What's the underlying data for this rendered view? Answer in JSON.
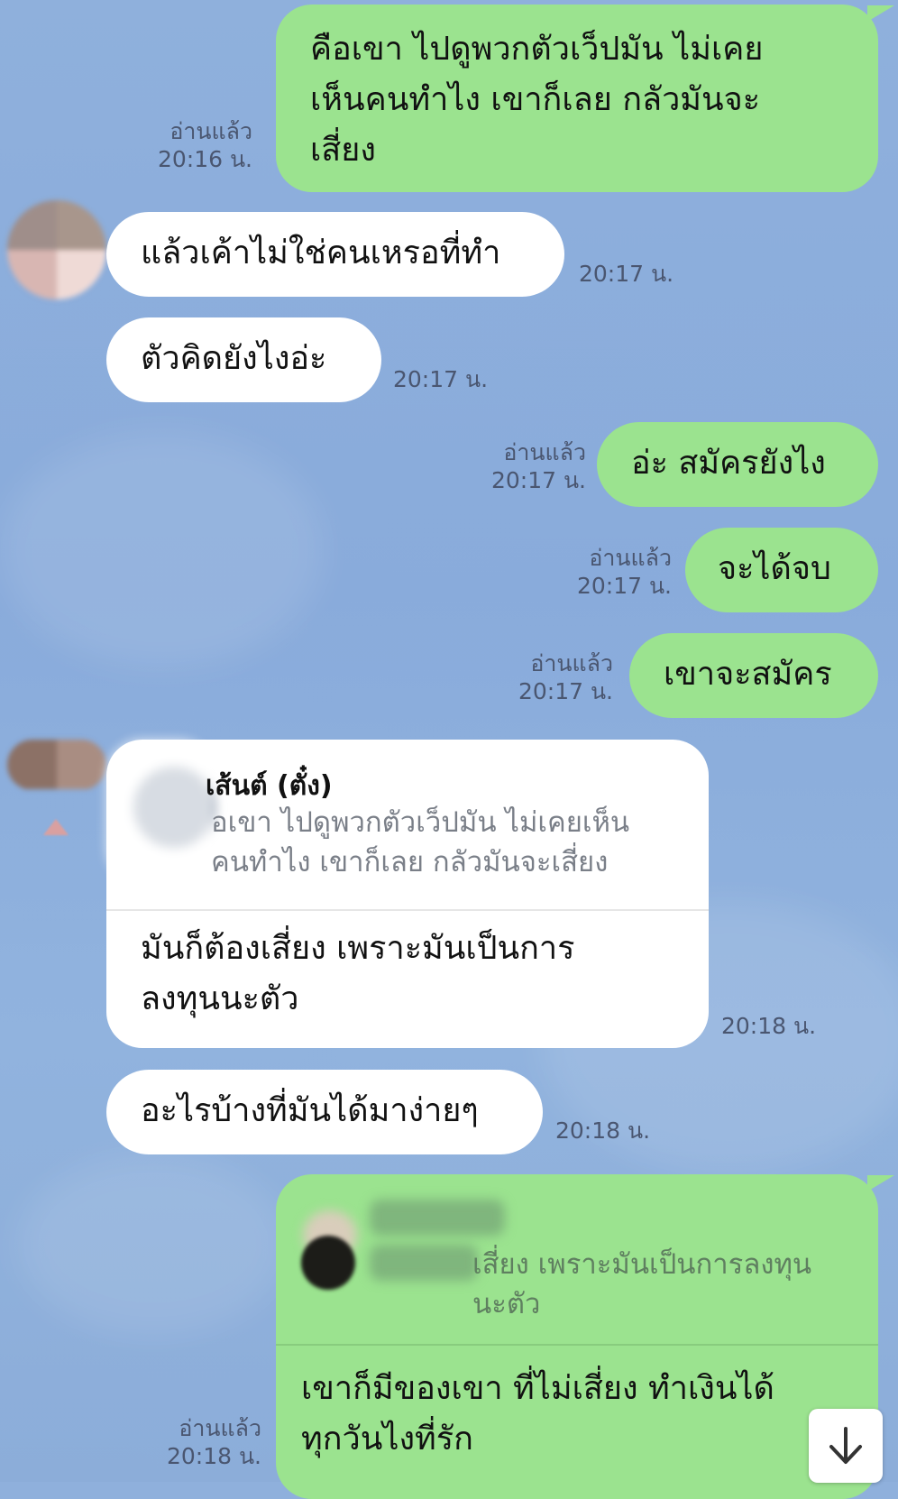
{
  "messages": [
    {
      "id": "m1",
      "text": "คือเขา ไปดูพวกตัวเว็ปมัน ไม่เคย\nเห็นคนทำไง เขาก็เลย กลัวมันจะ\nเสี่ยง",
      "read": "อ่านแล้ว",
      "time": "20:16 น."
    },
    {
      "id": "m2",
      "text": "แล้วเค้าไม่ใช่คนเหรอที่ทำ",
      "time": "20:17 น."
    },
    {
      "id": "m3",
      "text": "ตัวคิดยังไงอ่ะ",
      "time": "20:17 น."
    },
    {
      "id": "m4",
      "text": "อ่ะ สมัครยังไง",
      "read": "อ่านแล้ว",
      "time": "20:17 น."
    },
    {
      "id": "m5",
      "text": "จะได้จบ",
      "read": "อ่านแล้ว",
      "time": "20:17 น."
    },
    {
      "id": "m6",
      "text": "เขาจะสมัคร",
      "read": "อ่านแล้ว",
      "time": "20:17 น."
    },
    {
      "id": "m7",
      "reply_name": "เส้นต์ (ตั๋ง)",
      "reply_quote": "อเขา ไปดูพวกตัวเว็ปมัน ไม่เคยเห็น\nคนทำไง เขาก็เลย กลัวมันจะเสี่ยง",
      "text": "มันก็ต้องเสี่ยง เพราะมันเป็นการ\nลงทุนนะตัว",
      "time": "20:18 น."
    },
    {
      "id": "m8",
      "text": "อะไรบ้างที่มันได้มาง่ายๆ",
      "time": "20:18 น."
    },
    {
      "id": "m9",
      "reply_quote": "เสี่ยง เพราะมันเป็นการลงทุน\nนะตัว",
      "text": " เขาก็มีของเขา ที่ไม่เสี่ยง ทำเงินได้\nทุกวันไงที่รัก",
      "read": "อ่านแล้ว",
      "time": "20:18 น."
    }
  ],
  "colors": {
    "outgoing": "#9be38f",
    "incoming": "#ffffff",
    "background": "#8cadd9"
  },
  "scroll_button": {
    "icon": "arrow-down-icon"
  }
}
